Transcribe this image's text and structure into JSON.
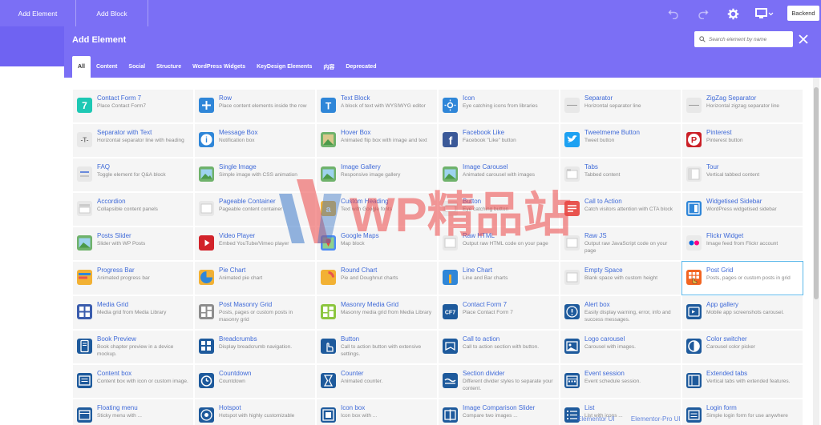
{
  "topbar": {
    "add_element_label": "Add Element",
    "add_block_label": "Add Block",
    "backend_label": "Backend",
    "icons": [
      "undo-icon",
      "redo-icon",
      "gear-icon",
      "monitor-icon"
    ]
  },
  "modal": {
    "title": "Add Element",
    "search_placeholder": "Search element by name",
    "tabs": [
      "All",
      "Content",
      "Social",
      "Structure",
      "WordPress Widgets",
      "KeyDesign Elements",
      "内容",
      "Deprecated"
    ],
    "active_tab": "All"
  },
  "elements": [
    {
      "name": "Contact Form 7",
      "desc": "Place Contact Form7",
      "icon": "contact-form-icon",
      "color": "#1ec8b4"
    },
    {
      "name": "Row",
      "desc": "Place content elements inside the row",
      "icon": "row-icon",
      "color": "#2f86d8"
    },
    {
      "name": "Text Block",
      "desc": "A block of text with WYSIWYG editor",
      "icon": "text-block-icon",
      "color": "#2f86d8"
    },
    {
      "name": "Icon",
      "desc": "Eye catching icons from libraries",
      "icon": "icon-icon",
      "color": "#2f86d8"
    },
    {
      "name": "Separator",
      "desc": "Horizontal separator line",
      "icon": "separator-icon",
      "color": "#e8e8e8"
    },
    {
      "name": "ZigZag Separator",
      "desc": "Horizontal zigzag separator line",
      "icon": "zigzag-separator-icon",
      "color": "#e8e8e8"
    },
    {
      "name": "Separator with Text",
      "desc": "Horizontal separator line with heading",
      "icon": "separator-text-icon",
      "color": "#e8e8e8"
    },
    {
      "name": "Message Box",
      "desc": "Notification box",
      "icon": "message-box-icon",
      "color": "#2f86d8"
    },
    {
      "name": "Hover Box",
      "desc": "Animated flip box with image and text",
      "icon": "hover-box-icon",
      "color": "#6fb26b"
    },
    {
      "name": "Facebook Like",
      "desc": "Facebook \"Like\" button",
      "icon": "facebook-icon",
      "color": "#3b5998"
    },
    {
      "name": "Tweetmeme Button",
      "desc": "Tweet button",
      "icon": "twitter-icon",
      "color": "#1da1f2"
    },
    {
      "name": "Pinterest",
      "desc": "Pinterest button",
      "icon": "pinterest-icon",
      "color": "#cb2027"
    },
    {
      "name": "FAQ",
      "desc": "Toggle element for Q&A block",
      "icon": "faq-icon",
      "color": "#e8e8e8"
    },
    {
      "name": "Single Image",
      "desc": "Simple image with CSS animation",
      "icon": "single-image-icon",
      "color": "#6fb26b"
    },
    {
      "name": "Image Gallery",
      "desc": "Responsive image gallery",
      "icon": "image-gallery-icon",
      "color": "#6fb26b"
    },
    {
      "name": "Image Carousel",
      "desc": "Animated carousel with images",
      "icon": "image-carousel-icon",
      "color": "#6fb26b"
    },
    {
      "name": "Tabs",
      "desc": "Tabbed content",
      "icon": "tabs-icon",
      "color": "#e8e8e8"
    },
    {
      "name": "Tour",
      "desc": "Vertical tabbed content",
      "icon": "tour-icon",
      "color": "#e8e8e8"
    },
    {
      "name": "Accordion",
      "desc": "Collapsible content panels",
      "icon": "accordion-icon",
      "color": "#e8e8e8"
    },
    {
      "name": "Pageable Container",
      "desc": "Pageable content container",
      "icon": "pageable-container-icon",
      "color": "#e8e8e8"
    },
    {
      "name": "Custom Heading",
      "desc": "Text with Google fonts",
      "icon": "custom-heading-icon",
      "color": "#f2b134"
    },
    {
      "name": "Button",
      "desc": "Eye catching button",
      "icon": "button-icon",
      "color": "#e8e8e8"
    },
    {
      "name": "Call to Action",
      "desc": "Catch visitors attention with CTA block",
      "icon": "call-to-action-icon",
      "color": "#e8544f"
    },
    {
      "name": "Widgetised Sidebar",
      "desc": "WordPress widgetised sidebar",
      "icon": "widgetised-sidebar-icon",
      "color": "#2f86d8"
    },
    {
      "name": "Posts Slider",
      "desc": "Slider with WP Posts",
      "icon": "posts-slider-icon",
      "color": "#6fb26b"
    },
    {
      "name": "Video Player",
      "desc": "Embed YouTube/Vimeo player",
      "icon": "video-player-icon",
      "color": "#d2232a"
    },
    {
      "name": "Google Maps",
      "desc": "Map block",
      "icon": "google-maps-icon",
      "color": "#4c8bf5"
    },
    {
      "name": "Raw HTML",
      "desc": "Output raw HTML code on your page",
      "icon": "raw-html-icon",
      "color": "#e8e8e8"
    },
    {
      "name": "Raw JS",
      "desc": "Output raw JavaScript code on your page",
      "icon": "raw-js-icon",
      "color": "#e8e8e8"
    },
    {
      "name": "Flickr Widget",
      "desc": "Image feed from Flickr account",
      "icon": "flickr-icon",
      "color": "#eaeaea"
    },
    {
      "name": "Progress Bar",
      "desc": "Animated progress bar",
      "icon": "progress-bar-icon",
      "color": "#f2b134"
    },
    {
      "name": "Pie Chart",
      "desc": "Animated pie chart",
      "icon": "pie-chart-icon",
      "color": "#f2b134"
    },
    {
      "name": "Round Chart",
      "desc": "Pie and Doughnut charts",
      "icon": "round-chart-icon",
      "color": "#f2b134"
    },
    {
      "name": "Line Chart",
      "desc": "Line and Bar charts",
      "icon": "line-chart-icon",
      "color": "#2f86d8"
    },
    {
      "name": "Empty Space",
      "desc": "Blank space with custom height",
      "icon": "empty-space-icon",
      "color": "#e8e8e8"
    },
    {
      "name": "Post Grid",
      "desc": "Posts, pages or custom posts in grid",
      "icon": "post-grid-icon",
      "color": "#f26522"
    },
    {
      "name": "Media Grid",
      "desc": "Media grid from Media Library",
      "icon": "media-grid-icon",
      "color": "#3a5cad"
    },
    {
      "name": "Post Masonry Grid",
      "desc": "Posts, pages or custom posts in masonry grid",
      "icon": "post-masonry-grid-icon",
      "color": "#8d8d8d"
    },
    {
      "name": "Masonry Media Grid",
      "desc": "Masonry media grid from Media Library",
      "icon": "masonry-media-grid-icon",
      "color": "#8cc63f"
    },
    {
      "name": "Contact Form 7",
      "desc": "Place Contact Form 7",
      "icon": "cf7-icon",
      "color": "#1e5a9c"
    },
    {
      "name": "Alert box",
      "desc": "Easily display warning, error, info and success messages.",
      "icon": "alert-box-icon",
      "color": "#1e5a9c"
    },
    {
      "name": "App gallery",
      "desc": "Mobile app screenshots carousel.",
      "icon": "app-gallery-icon",
      "color": "#1e5a9c"
    },
    {
      "name": "Book Preview",
      "desc": "Book chapter preview in a device mockup.",
      "icon": "book-preview-icon",
      "color": "#1e5a9c"
    },
    {
      "name": "Breadcrumbs",
      "desc": "Display breadcrumb navigation.",
      "icon": "breadcrumbs-icon",
      "color": "#1e5a9c"
    },
    {
      "name": "Button",
      "desc": "Call to action button with extensive settings.",
      "icon": "kd-button-icon",
      "color": "#1e5a9c"
    },
    {
      "name": "Call to action",
      "desc": "Call to action section with button.",
      "icon": "kd-call-to-action-icon",
      "color": "#1e5a9c"
    },
    {
      "name": "Logo carousel",
      "desc": "Carousel with images.",
      "icon": "logo-carousel-icon",
      "color": "#1e5a9c"
    },
    {
      "name": "Color switcher",
      "desc": "Carousel color picker",
      "icon": "color-switcher-icon",
      "color": "#1e5a9c"
    },
    {
      "name": "Content box",
      "desc": "Content box with icon or custom image.",
      "icon": "content-box-icon",
      "color": "#1e5a9c"
    },
    {
      "name": "Countdown",
      "desc": "Countdown",
      "icon": "countdown-icon",
      "color": "#1e5a9c"
    },
    {
      "name": "Counter",
      "desc": "Animated counter.",
      "icon": "counter-icon",
      "color": "#1e5a9c"
    },
    {
      "name": "Section divider",
      "desc": "Different divider styles to separate your content.",
      "icon": "section-divider-icon",
      "color": "#1e5a9c"
    },
    {
      "name": "Event session",
      "desc": "Event schedule session.",
      "icon": "event-session-icon",
      "color": "#1e5a9c"
    },
    {
      "name": "Extended tabs",
      "desc": "Vertical tabs with extended features.",
      "icon": "extended-tabs-icon",
      "color": "#1e5a9c"
    },
    {
      "name": "Floating menu",
      "desc": "Sticky menu with ...",
      "icon": "floating-menu-icon",
      "color": "#1e5a9c"
    },
    {
      "name": "Hotspot",
      "desc": "Hotspot with highly customizable",
      "icon": "hotspot-icon",
      "color": "#1e5a9c"
    },
    {
      "name": "Icon box",
      "desc": "Icon box with ...",
      "icon": "icon-box-icon",
      "color": "#1e5a9c"
    },
    {
      "name": "Image Comparison Slider",
      "desc": "Compare two images ...",
      "icon": "image-comparison-icon",
      "color": "#1e5a9c"
    },
    {
      "name": "List",
      "desc": "List with icons ...",
      "icon": "list-icon",
      "color": "#1e5a9c"
    },
    {
      "name": "Login form",
      "desc": "Simple login form for use anywhere",
      "icon": "login-form-icon",
      "color": "#1e5a9c"
    }
  ],
  "selected_index": 35,
  "watermark": {
    "text": "WP精品站"
  },
  "bottom_overlay": [
    "Elementor UI",
    "Elementor-Pro UI"
  ]
}
